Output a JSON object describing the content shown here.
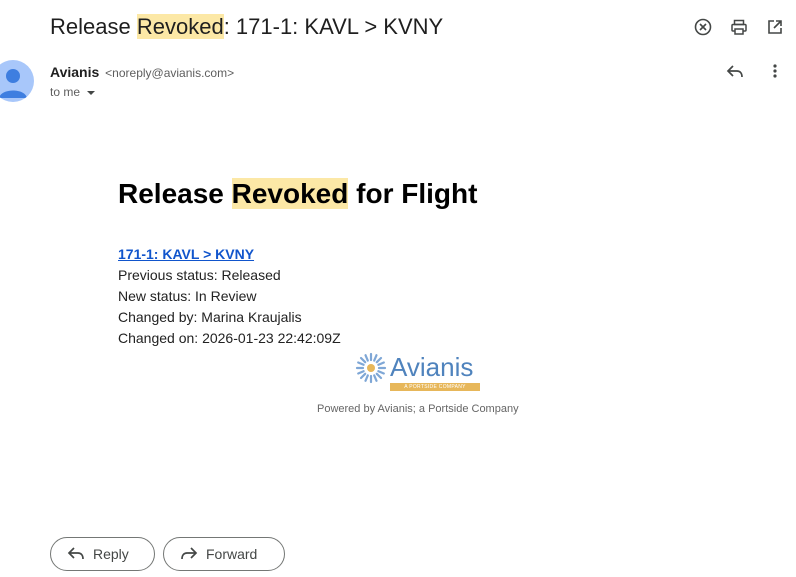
{
  "email": {
    "subject": {
      "prefix": "Release ",
      "highlight": "Revoked",
      "suffix": ": 171-1: KAVL > KVNY"
    },
    "sender": {
      "name": "Avianis",
      "email": "<noreply@avianis.com>",
      "recipient_label": "to me"
    },
    "body": {
      "heading": {
        "prefix": "Release ",
        "highlight": "Revoked",
        "suffix": " for Flight"
      },
      "flight_link": "171-1: KAVL > KVNY",
      "lines": [
        "Previous status: Released",
        "New status: In Review",
        "Changed by: Marina Kraujalis",
        "Changed on: 2026-01-23 22:42:09Z"
      ],
      "logo": {
        "wordmark": "Avianis",
        "tagline": "A PORTSIDE COMPANY"
      },
      "footer": "Powered by Avianis; a Portside Company"
    },
    "actions": {
      "reply": "Reply",
      "forward": "Forward"
    }
  },
  "icons": {
    "top": [
      "close-circle-icon",
      "print-icon",
      "open-in-new-icon"
    ],
    "message": [
      "reply-icon",
      "more-vert-icon"
    ],
    "logo_mark": "sunburst-logo-icon"
  },
  "colors": {
    "highlight": "#fce8a6",
    "link": "#1155cc",
    "brand_blue": "#4f83bd",
    "brand_gold": "#e7b75a",
    "avatar": "#a8c7fa"
  }
}
